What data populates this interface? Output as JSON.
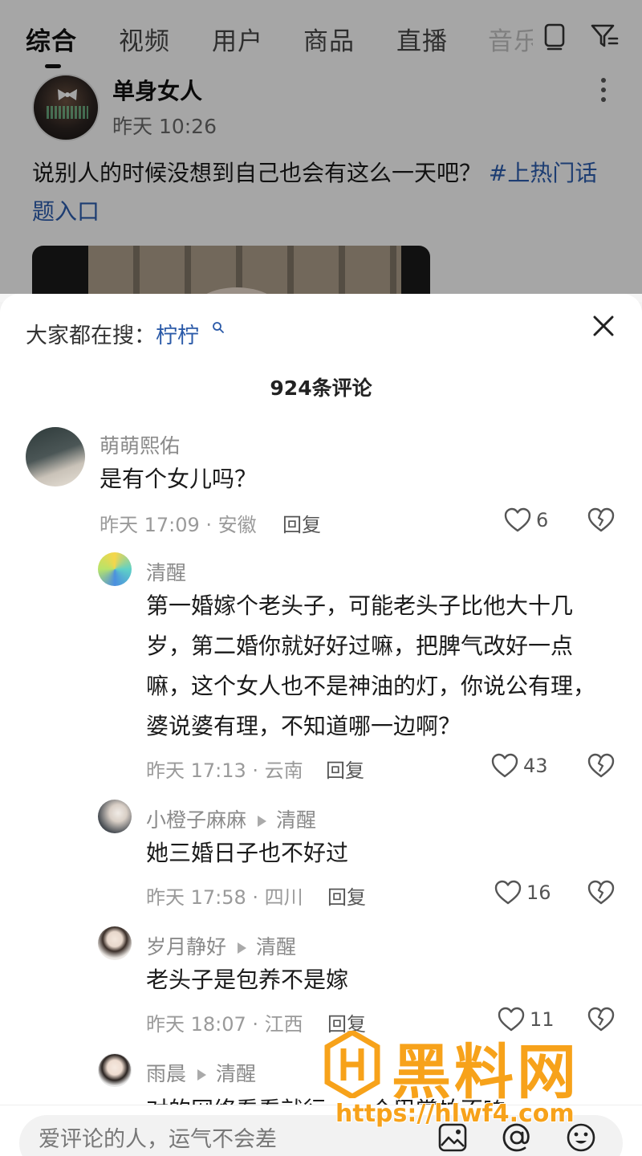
{
  "tabs": [
    {
      "label": "综合",
      "active": true
    },
    {
      "label": "视频"
    },
    {
      "label": "用户"
    },
    {
      "label": "商品"
    },
    {
      "label": "直播"
    },
    {
      "label": "音乐"
    }
  ],
  "top_icons": [
    "tablet-icon",
    "filter-icon"
  ],
  "post": {
    "author": "单身女人",
    "time": "昨天 10:26",
    "text": "说别人的时候没想到自己也会有这么一天吧？ ",
    "hashtag": "#上热门话题入口"
  },
  "sheet": {
    "search_prefix": "大家都在搜：",
    "search_keyword": "柠柠",
    "comment_count": "924条评论"
  },
  "comments": [
    {
      "name": "萌萌熙佑",
      "text": "是有个女儿吗？",
      "meta": "昨天 17:09 · 安徽",
      "reply": "回复",
      "likes": "6"
    },
    {
      "name": "清醒",
      "text": "第一婚嫁个老头子，可能老头子比他大十几岁，第二婚你就好好过嘛，把脾气改好一点嘛，这个女人也不是神油的灯，你说公有理，婆说婆有理，不知道哪一边啊？",
      "meta": "昨天 17:13 · 云南",
      "reply": "回复",
      "likes": "43"
    },
    {
      "name": "小橙子麻麻",
      "reply_to": "清醒",
      "text": "她三婚日子也不好过",
      "meta": "昨天 17:58 · 四川",
      "reply": "回复",
      "likes": "16"
    },
    {
      "name": "岁月静好",
      "reply_to": "清醒",
      "text": "老头子是包养不是嫁",
      "meta": "昨天 18:07 · 江西",
      "reply": "回复",
      "likes": "11"
    },
    {
      "name": "雨晨",
      "reply_to": "清醒",
      "text": "对的网络看看就行，一个巴掌拍不响"
    }
  ],
  "input": {
    "placeholder": "爱评论的人，运气不会差"
  },
  "input_icons": [
    "image-icon",
    "at-icon",
    "emoji-icon"
  ],
  "watermark": {
    "title": "黑料网",
    "url": "https://hlwf4.com"
  },
  "colors": {
    "link": "#2b5aa8",
    "watermark": "#f7a21a"
  }
}
